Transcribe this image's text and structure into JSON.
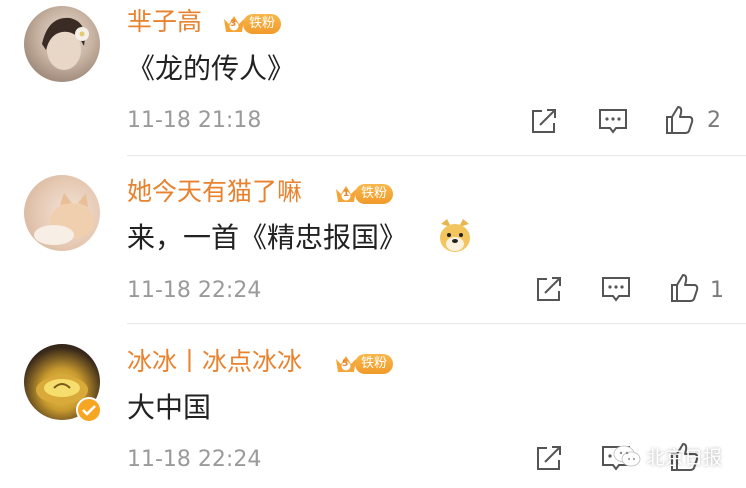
{
  "comments": [
    {
      "username": "芈子高",
      "badge": {
        "level": "3",
        "label": "铁粉"
      },
      "text": "《龙的传人》",
      "time": "11-18 21:18",
      "likes": "2"
    },
    {
      "username": "她今天有猫了嘛",
      "badge": {
        "level": "1",
        "label": "铁粉"
      },
      "text": "来，一首《精忠报国》",
      "time": "11-18 22:24",
      "likes": "1"
    },
    {
      "username": "冰冰丨冰点冰冰",
      "badge": {
        "level": "5",
        "label": "铁粉"
      },
      "text": "大中国",
      "time": "11-18 22:24",
      "likes": ""
    }
  ],
  "watermark": {
    "text": "北京日报",
    "icon": "wechat-icon"
  },
  "colors": {
    "username": "#e8822e",
    "badge": "#f3a537",
    "time": "#9a9a9a",
    "text": "#222222"
  }
}
